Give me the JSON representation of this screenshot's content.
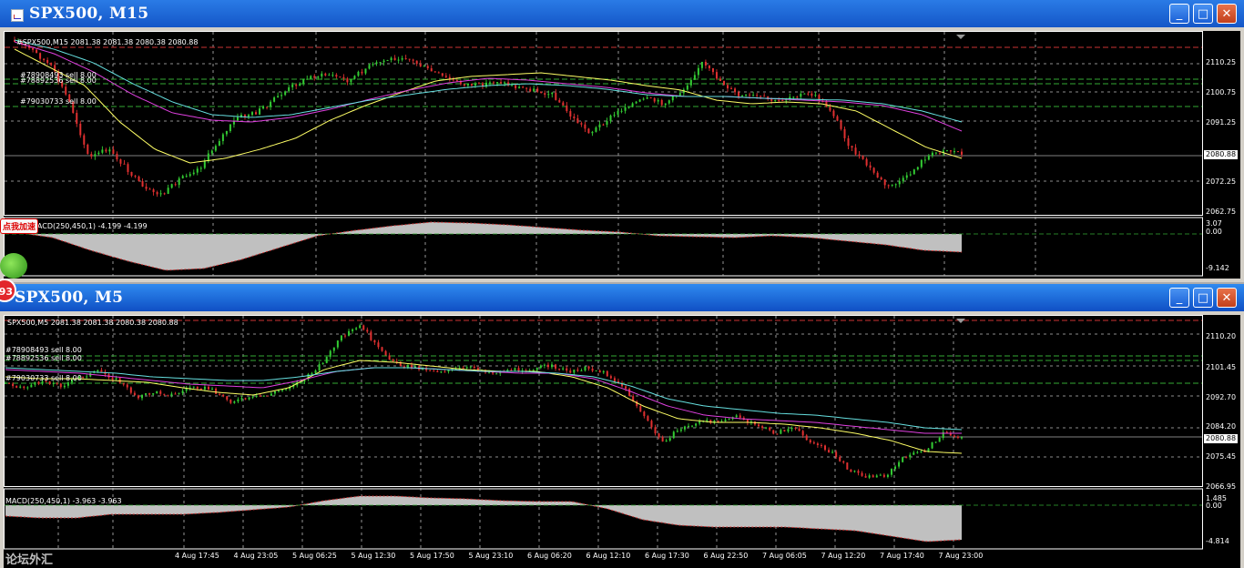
{
  "colors": {
    "ma_yellow": "#FFFF66",
    "ma_magenta": "#E040E0",
    "ma_cyan": "#66E0E0",
    "bull": "#33CC33",
    "bear": "#E03030",
    "sell_line": "#CC3333",
    "order_line": "#33AA33",
    "macd": "#C0C0C0"
  },
  "m15": {
    "title": "SPX500, M15",
    "header": "#SPX500,M15  2081.38 2081.38 2080.38 2080.88",
    "orders": [
      "#78908493 sell 8.00",
      "#78892536 sell 8.00",
      "#79030733 sell 8.00"
    ],
    "price_labels": [
      "2110.25",
      "2100.75",
      "2091.25",
      "2072.25",
      "2062.75"
    ],
    "current_price": "2080.88",
    "macd_label": "MACD(250,450,1) -4.199 -4.199",
    "macd_axis": [
      "3.07",
      "0.00",
      "-9.142"
    ]
  },
  "m5": {
    "title": "SPX500, M5",
    "header": "SPX500,M5  2081.38 2081.38 2080.38 2080.88",
    "orders": [
      "#78908493 sell 8.00",
      "#78892536 sell 8.00",
      "#79030733 sell 8.00"
    ],
    "price_labels": [
      "2110.20",
      "2101.45",
      "2092.70",
      "2084.20",
      "2075.45",
      "2066.95"
    ],
    "current_price": "2080.88",
    "macd_label": "MACD(250,450,1) -3.963 -3.963",
    "macd_axis": [
      "1.485",
      "0.00",
      "-4.814"
    ],
    "time_labels": [
      "4 Aug 17:45",
      "4 Aug 23:05",
      "5 Aug 06:25",
      "5 Aug 12:30",
      "5 Aug 17:50",
      "5 Aug 23:10",
      "6 Aug 06:20",
      "6 Aug 12:10",
      "6 Aug 17:30",
      "6 Aug 22:50",
      "7 Aug 06:05",
      "7 Aug 12:20",
      "7 Aug 17:40",
      "7 Aug 23:00"
    ]
  },
  "overlay": {
    "badge_text": "点我加速",
    "circle_text": "93",
    "watermark": "论坛外汇"
  }
}
